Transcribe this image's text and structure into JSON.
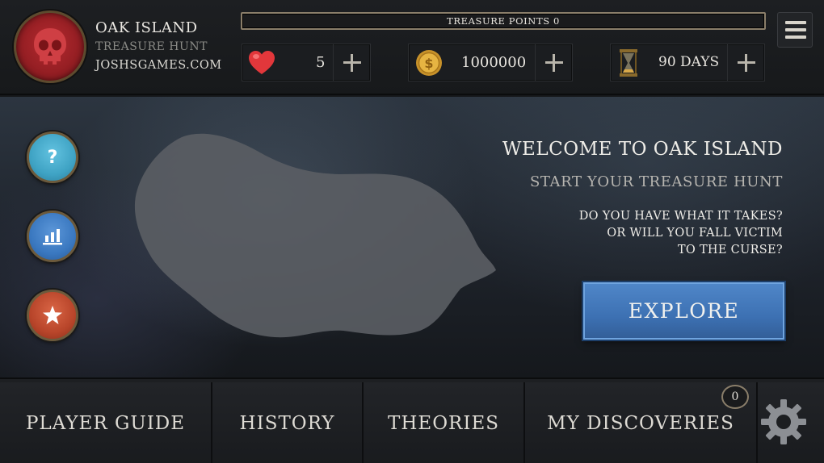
{
  "header": {
    "title": "OAK ISLAND",
    "subtitle": "TREASURE HUNT",
    "site": "JOSHSGAMES.COM",
    "points_label": "TREASURE POINTS 0",
    "points_progress": 0
  },
  "stats": {
    "lives": "5",
    "coins": "1000000",
    "days": "90 DAYS"
  },
  "icons": {
    "avatar": "skull-icon",
    "lives": "heart-icon",
    "coins": "coin-icon",
    "days": "hourglass-icon",
    "menu": "hamburger-menu-icon",
    "help": "question-icon",
    "stats": "bar-chart-icon",
    "favorites": "star-icon",
    "settings": "gear-icon"
  },
  "main": {
    "welcome": "WELCOME TO OAK ISLAND",
    "start": "Start YOUR TREASURE HUNT",
    "question_lines": [
      "DO YOU HAVE WHAT IT TAKES?",
      "OR WILL YOU FALL VICTIM",
      "TO THE CURSE?"
    ],
    "explore_label": "EXPLORE"
  },
  "nav": {
    "player_guide": "PLAYER GUIDE",
    "history": "HISTORY",
    "theories": "THEORIES",
    "my_discoveries": "MY DISCOVERIES",
    "discoveries_count": "0"
  },
  "colors": {
    "help_button": "#3fa3c4",
    "stats_button": "#3a78c0",
    "favorites_button": "#b8452a",
    "explore_button": "#4179bd",
    "avatar_red": "#a82428"
  }
}
